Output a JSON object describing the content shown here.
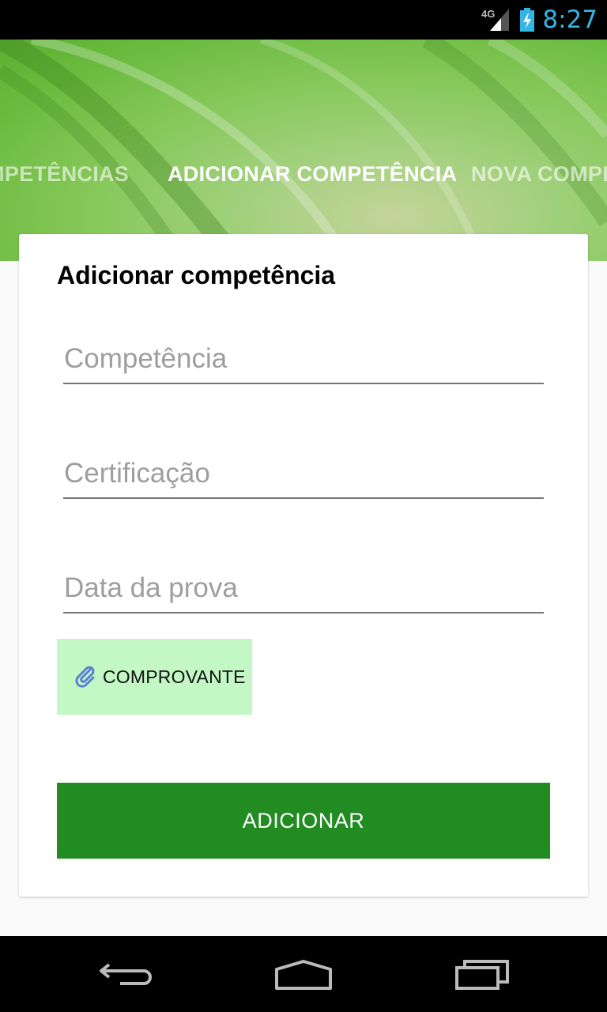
{
  "status_bar": {
    "network": "4G",
    "time": "8:27",
    "icons": [
      "signal-icon",
      "battery-charging-icon"
    ]
  },
  "tabs": [
    {
      "label": "COMPETÊNCIAS",
      "active": false
    },
    {
      "label": "ADICIONAR COMPETÊNCIA",
      "active": true
    },
    {
      "label": "NOVA COMPETÊNCIA",
      "active": false
    }
  ],
  "form": {
    "title": "Adicionar competência",
    "fields": [
      {
        "placeholder": "Competência",
        "value": ""
      },
      {
        "placeholder": "Certificação",
        "value": ""
      },
      {
        "placeholder": "Data da prova",
        "value": ""
      }
    ],
    "attach_label": "COMPROVANTE",
    "attach_icon": "paperclip-icon",
    "submit_label": "ADICIONAR"
  },
  "nav_bar": {
    "icons": [
      "back-icon",
      "home-icon",
      "recents-icon"
    ]
  },
  "colors": {
    "accent_blue": "#33b5e5",
    "submit_green": "#228b22",
    "attach_bg": "#c3f7c3",
    "header_green": "#86c85a"
  }
}
